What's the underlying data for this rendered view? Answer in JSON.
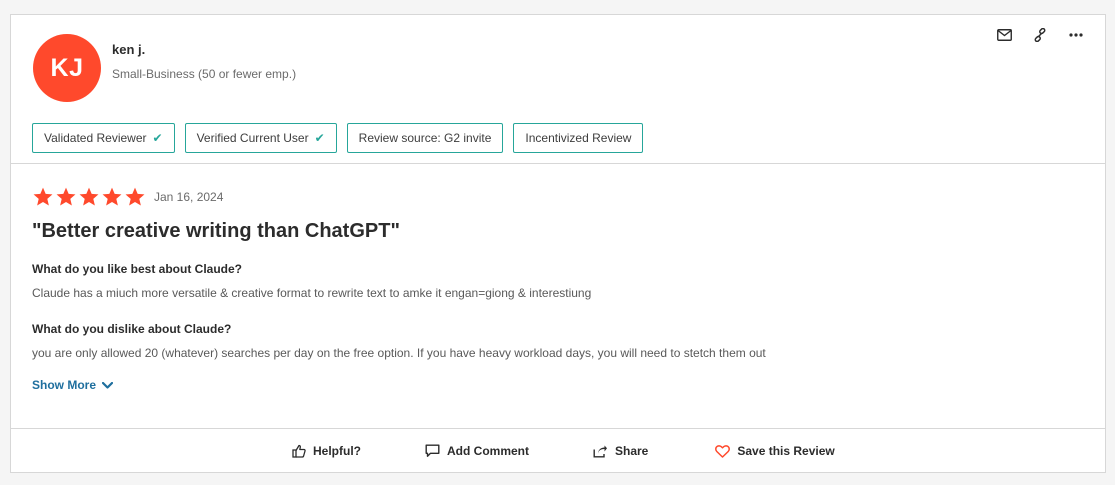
{
  "reviewer": {
    "initials": "KJ",
    "name": "ken j.",
    "segment": "Small-Business (50 or fewer emp.)",
    "avatar_color": "#ff492c"
  },
  "top_actions": [
    {
      "icon": "mail-icon"
    },
    {
      "icon": "link-icon"
    },
    {
      "icon": "more-icon"
    }
  ],
  "badges": [
    {
      "label": "Validated Reviewer",
      "checked": true
    },
    {
      "label": "Verified Current User",
      "checked": true
    },
    {
      "label": "Review source: G2 invite",
      "checked": false
    },
    {
      "label": "Incentivized Review",
      "checked": false
    }
  ],
  "review": {
    "rating": 5,
    "rating_max": 5,
    "star_color": "#ff492c",
    "date": "Jan 16, 2024",
    "title": "\"Better creative writing than ChatGPT\"",
    "like_question": "What do you like best about Claude?",
    "like_answer": "Claude has a miuch more versatile & creative format to rewrite text to amke it engan=giong & interestiung",
    "dislike_question": "What do you dislike about Claude?",
    "dislike_answer": "you are only allowed 20 (whatever) searches per day on the free option. If you have heavy workload days, you will need to stetch them out",
    "show_more": "Show More"
  },
  "footer": {
    "helpful": "Helpful?",
    "comment": "Add Comment",
    "share": "Share",
    "save": "Save this Review"
  },
  "colors": {
    "badge_border": "#26a69a",
    "link": "#1f6f9e"
  }
}
